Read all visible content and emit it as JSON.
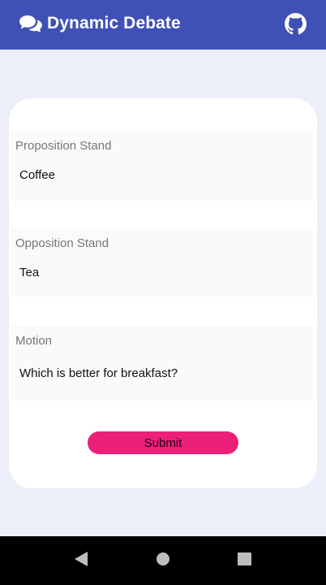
{
  "app": {
    "title": "Dynamic Debate",
    "brand_icon": "comments-icon",
    "action_icon": "github-icon",
    "bar_color": "#3f51b5"
  },
  "form": {
    "proposition": {
      "label": "Proposition Stand",
      "value": "Coffee"
    },
    "opposition": {
      "label": "Opposition Stand",
      "value": "Tea"
    },
    "motion": {
      "label": "Motion",
      "value": "Which is better for breakfast?"
    },
    "submit_label": "Submit",
    "submit_color": "#ec1f7a"
  },
  "system_nav": {
    "back_icon": "back-triangle-icon",
    "home_icon": "home-circle-icon",
    "recents_icon": "recents-square-icon"
  }
}
